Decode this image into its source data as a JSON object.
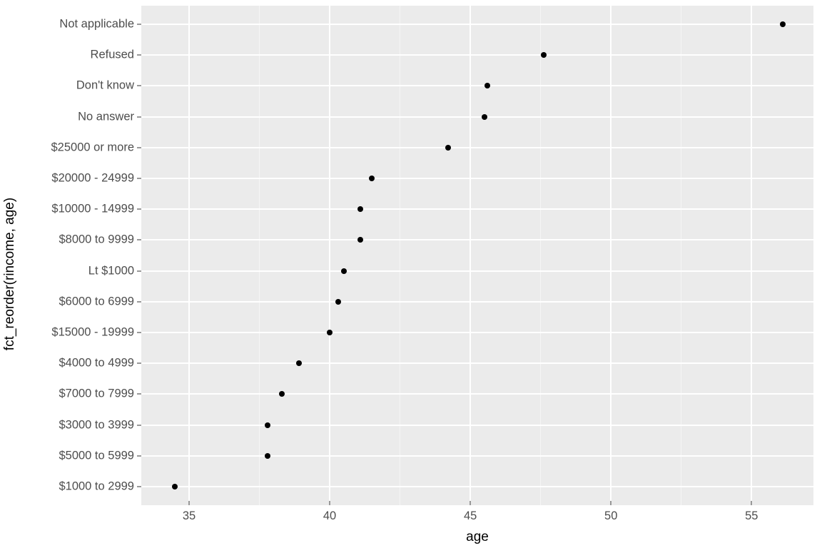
{
  "chart_data": {
    "type": "scatter",
    "xlabel": "age",
    "ylabel": "fct_reorder(rincome, age)",
    "xlim": [
      33.3,
      57.2
    ],
    "x_major_ticks": [
      35,
      40,
      45,
      50,
      55
    ],
    "x_minor_ticks": [
      37.5,
      42.5,
      47.5,
      52.5
    ],
    "categories_top_to_bottom": [
      "Not applicable",
      "Refused",
      "Don't know",
      "No answer",
      "$25000 or more",
      "$20000 - 24999",
      "$10000 - 14999",
      "$8000 to 9999",
      "Lt $1000",
      "$6000 to 6999",
      "$15000 - 19999",
      "$4000 to 4999",
      "$7000 to 7999",
      "$3000 to 3999",
      "$5000 to 5999",
      "$1000 to 2999"
    ],
    "points": [
      {
        "category": "Not applicable",
        "age": 56.1
      },
      {
        "category": "Refused",
        "age": 47.6
      },
      {
        "category": "Don't know",
        "age": 45.6
      },
      {
        "category": "No answer",
        "age": 45.5
      },
      {
        "category": "$25000 or more",
        "age": 44.2
      },
      {
        "category": "$20000 - 24999",
        "age": 41.5
      },
      {
        "category": "$10000 - 14999",
        "age": 41.1
      },
      {
        "category": "$8000 to 9999",
        "age": 41.1
      },
      {
        "category": "Lt $1000",
        "age": 40.5
      },
      {
        "category": "$6000 to 6999",
        "age": 40.3
      },
      {
        "category": "$15000 - 19999",
        "age": 40.0
      },
      {
        "category": "$4000 to 4999",
        "age": 38.9
      },
      {
        "category": "$7000 to 7999",
        "age": 38.3
      },
      {
        "category": "$3000 to 3999",
        "age": 37.8
      },
      {
        "category": "$5000 to 5999",
        "age": 37.8
      },
      {
        "category": "$1000 to 2999",
        "age": 34.5
      }
    ]
  }
}
